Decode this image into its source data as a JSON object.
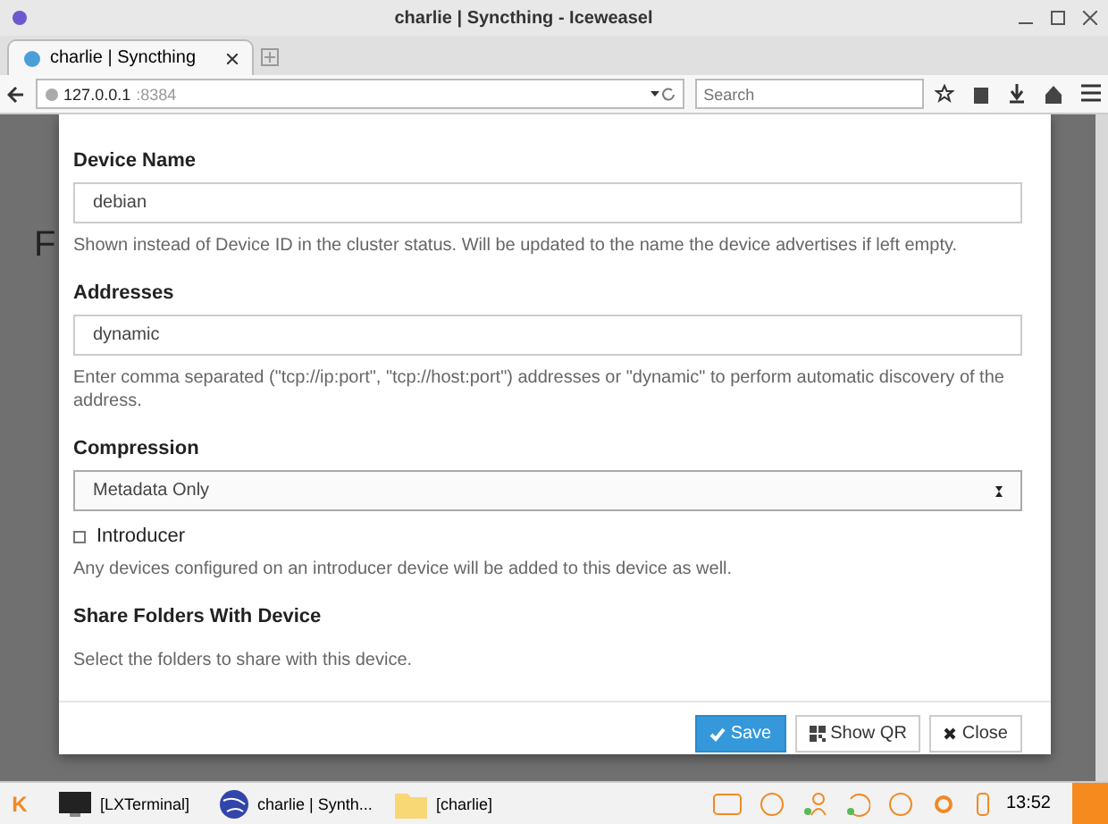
{
  "window": {
    "title": "charlie | Syncthing - Iceweasel"
  },
  "tabs": [
    {
      "label": "charlie | Syncthing",
      "selected": true
    }
  ],
  "address_bar": {
    "host": "127.0.0.1",
    "rest": ":8384"
  },
  "search": {
    "placeholder": "Search"
  },
  "page": {
    "heading": "F"
  },
  "modal": {
    "fields": [
      {
        "kind": "text",
        "label": "Device Name",
        "value": "debian",
        "help": "Shown instead of Device ID in the cluster status. Will be updated to the name the device advertises if left empty."
      },
      {
        "kind": "text",
        "label": "Addresses",
        "value": "dynamic",
        "help": "Enter comma separated (\"tcp://ip:port\", \"tcp://host:port\") addresses or \"dynamic\" to perform automatic discovery of the address."
      },
      {
        "kind": "select",
        "label": "Compression",
        "value": "Metadata Only"
      },
      {
        "kind": "checkbox",
        "label": "Introducer",
        "checked": false,
        "help": "Any devices configured on an introducer device will be added to this device as well."
      },
      {
        "kind": "section",
        "label": "Share Folders With Device",
        "help": "Select the folders to share with this device."
      }
    ],
    "buttons": [
      {
        "label": "Save",
        "kind": "primary"
      },
      {
        "label": "Show QR",
        "kind": "default"
      },
      {
        "label": "Close",
        "kind": "default"
      }
    ]
  },
  "taskbar": {
    "start": "K",
    "tasks": [
      {
        "label": "[LXTerminal]"
      },
      {
        "label": "charlie | Synth..."
      },
      {
        "label": "[charlie]"
      }
    ],
    "clock": "13:52"
  }
}
